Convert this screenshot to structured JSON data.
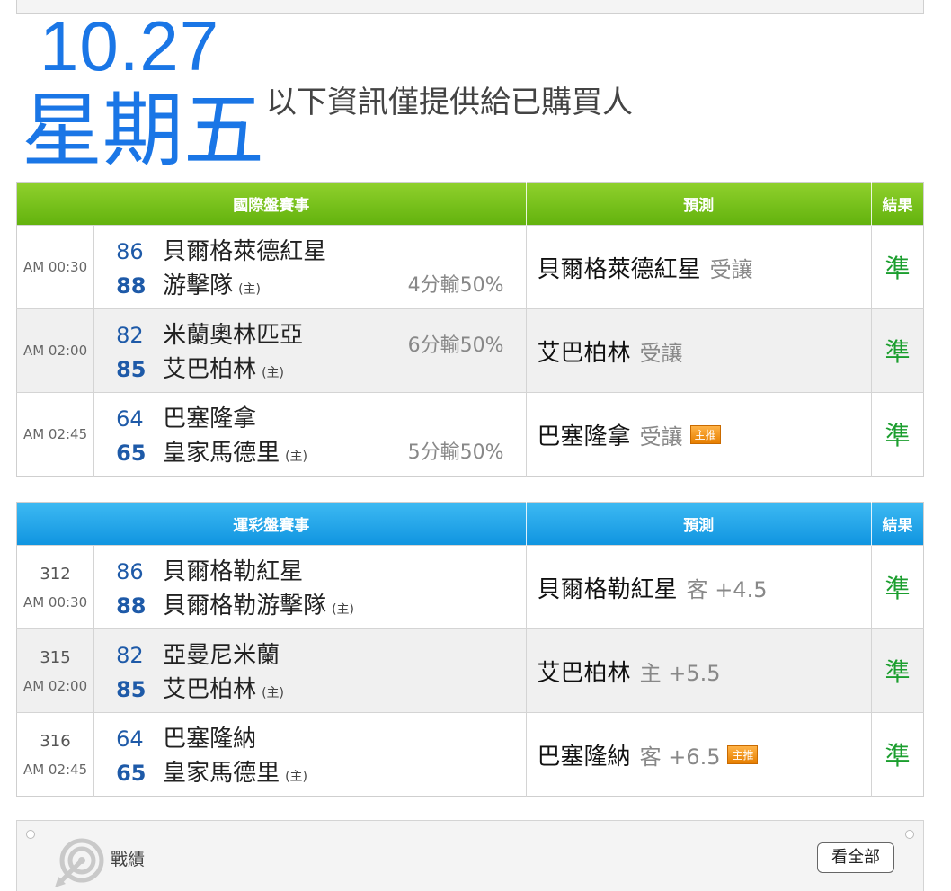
{
  "header": {
    "date": "10.27",
    "weekday": "星期五",
    "notice": "以下資訊僅提供給已購買人"
  },
  "intl": {
    "headers": [
      "國際盤賽事",
      "預測",
      "結果"
    ],
    "rows": [
      {
        "time": "AM 00:30",
        "away_score": "86",
        "away": "貝爾格萊德紅星",
        "home_score": "88",
        "home": "游擊隊",
        "host": "(主)",
        "spread": "4分輸50%",
        "spread_pos": "bottom",
        "pick": "貝爾格萊德紅星",
        "pick_sub": "受讓",
        "badge": "",
        "result": "準"
      },
      {
        "time": "AM 02:00",
        "away_score": "82",
        "away": "米蘭奧林匹亞",
        "home_score": "85",
        "home": "艾巴柏林",
        "host": "(主)",
        "spread": "6分輸50%",
        "spread_pos": "top",
        "pick": "艾巴柏林",
        "pick_sub": "受讓",
        "badge": "",
        "result": "準"
      },
      {
        "time": "AM 02:45",
        "away_score": "64",
        "away": "巴塞隆拿",
        "home_score": "65",
        "home": "皇家馬德里",
        "host": "(主)",
        "spread": "5分輸50%",
        "spread_pos": "bottom",
        "pick": "巴塞隆拿",
        "pick_sub": "受讓",
        "badge": "主推",
        "result": "準"
      }
    ]
  },
  "lottery": {
    "headers": [
      "運彩盤賽事",
      "預測",
      "結果"
    ],
    "rows": [
      {
        "num": "312",
        "time": "AM 00:30",
        "away_score": "86",
        "away": "貝爾格勒紅星",
        "home_score": "88",
        "home": "貝爾格勒游擊隊",
        "host": "(主)",
        "pick": "貝爾格勒紅星",
        "pick_sub": "客 +4.5",
        "badge": "",
        "result": "準"
      },
      {
        "num": "315",
        "time": "AM 02:00",
        "away_score": "82",
        "away": "亞曼尼米蘭",
        "home_score": "85",
        "home": "艾巴柏林",
        "host": "(主)",
        "pick": "艾巴柏林",
        "pick_sub": "主 +5.5",
        "badge": "",
        "result": "準"
      },
      {
        "num": "316",
        "time": "AM 02:45",
        "away_score": "64",
        "away": "巴塞隆納",
        "home_score": "65",
        "home": "皇家馬德里",
        "host": "(主)",
        "pick": "巴塞隆納",
        "pick_sub": "客 +6.5",
        "badge": "主推",
        "result": "準"
      }
    ]
  },
  "record": {
    "icon": "target-icon",
    "label": "戰績",
    "button": "看全部"
  }
}
